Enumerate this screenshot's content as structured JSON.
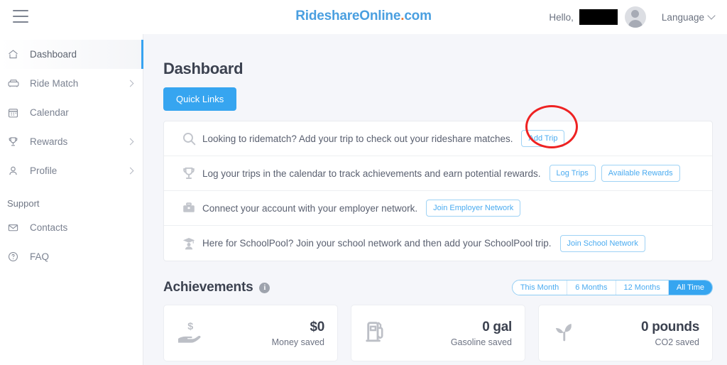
{
  "header": {
    "menu_icon": "hamburger-icon",
    "brand_name": "RideshareOnline",
    "brand_dot": ".",
    "brand_tld": "com",
    "greeting": "Hello,",
    "avatar_icon": "user-avatar-icon",
    "language_label": "Language",
    "language_chevron": "chevron-down-icon"
  },
  "sidebar": {
    "items": [
      {
        "label": "Dashboard",
        "icon": "home-icon",
        "active": true,
        "chevron": false
      },
      {
        "label": "Ride Match",
        "icon": "car-icon",
        "active": false,
        "chevron": true
      },
      {
        "label": "Calendar",
        "icon": "calendar-icon",
        "active": false,
        "chevron": false
      },
      {
        "label": "Rewards",
        "icon": "trophy-icon",
        "active": false,
        "chevron": true
      },
      {
        "label": "Profile",
        "icon": "person-icon",
        "active": false,
        "chevron": true
      }
    ],
    "section_label": "Support",
    "support_items": [
      {
        "label": "Contacts",
        "icon": "envelope-icon"
      },
      {
        "label": "FAQ",
        "icon": "question-circle-icon"
      }
    ]
  },
  "main": {
    "page_title": "Dashboard",
    "quick_links_button": "Quick Links",
    "quick_links": [
      {
        "icon": "search-icon",
        "text": "Looking to ridematch? Add your trip to check out your rideshare matches.",
        "buttons": [
          "Add Trip"
        ]
      },
      {
        "icon": "trophy-icon",
        "text": "Log your trips in the calendar to track achievements and earn potential rewards.",
        "buttons": [
          "Log Trips",
          "Available Rewards"
        ]
      },
      {
        "icon": "briefcase-icon",
        "text": "Connect your account with your employer network.",
        "buttons": [
          "Join Employer Network"
        ]
      },
      {
        "icon": "graduate-icon",
        "text": "Here for SchoolPool? Join your school network and then add your SchoolPool trip.",
        "buttons": [
          "Join School Network"
        ]
      }
    ],
    "achievements": {
      "title": "Achievements",
      "info_icon": "info-icon",
      "info_glyph": "i",
      "filters": [
        {
          "label": "This Month",
          "active": false
        },
        {
          "label": "6 Months",
          "active": false
        },
        {
          "label": "12 Months",
          "active": false
        },
        {
          "label": "All Time",
          "active": true
        }
      ],
      "stats": [
        {
          "icon": "hand-money-icon",
          "value": "$0",
          "label": "Money saved"
        },
        {
          "icon": "fuel-pump-icon",
          "value": "0 gal",
          "label": "Gasoline saved"
        },
        {
          "icon": "sprout-leaf-icon",
          "value": "0 pounds",
          "label": "CO2 saved"
        }
      ]
    }
  },
  "annotation": {
    "shape": "red-ellipse-highlight",
    "target": "Add Trip",
    "color": "#ee2222"
  },
  "colors": {
    "accent_blue": "#36a5f0",
    "brand_blue": "#4a9fe0",
    "brand_orange": "#f07c32",
    "page_bg": "#f5f6fa",
    "annotation_red": "#ee2222"
  }
}
